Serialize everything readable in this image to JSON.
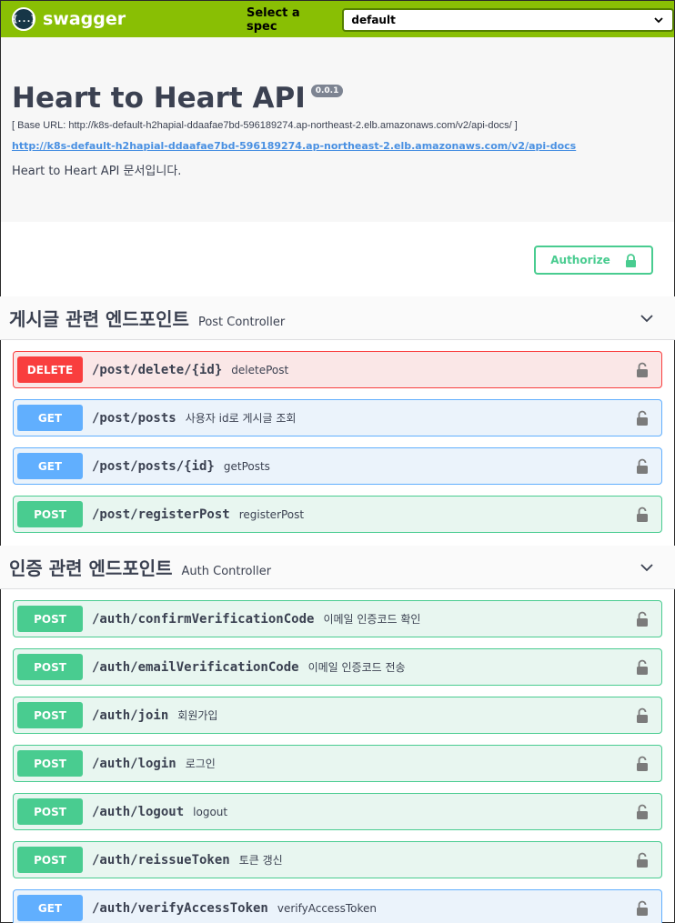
{
  "topbar": {
    "logo_glyph": "{...}",
    "logo_text": "swagger",
    "spec_label": "Select a spec",
    "spec_value": "default"
  },
  "info": {
    "title": "Heart to Heart API",
    "version": "0.0.1",
    "base_url": "[ Base URL: http://k8s-default-h2hapial-ddaafae7bd-596189274.ap-northeast-2.elb.amazonaws.com/v2/api-docs/ ]",
    "docs_link": "http://k8s-default-h2hapial-ddaafae7bd-596189274.ap-northeast-2.elb.amazonaws.com/v2/api-docs",
    "description": "Heart to Heart API 문서입니다."
  },
  "authorize": {
    "label": "Authorize"
  },
  "colors": {
    "get": "#61affe",
    "post": "#49cc90",
    "delete": "#f93e3e",
    "topbar": "#89bf04"
  },
  "sections": [
    {
      "name": "게시글 관련 엔드포인트",
      "desc": "Post Controller",
      "operations": [
        {
          "method": "DELETE",
          "path": "/post/delete/{id}",
          "summary": "deletePost"
        },
        {
          "method": "GET",
          "path": "/post/posts",
          "summary": "사용자 id로 게시글 조회"
        },
        {
          "method": "GET",
          "path": "/post/posts/{id}",
          "summary": "getPosts"
        },
        {
          "method": "POST",
          "path": "/post/registerPost",
          "summary": "registerPost"
        }
      ]
    },
    {
      "name": "인증 관련 엔드포인트",
      "desc": "Auth Controller",
      "operations": [
        {
          "method": "POST",
          "path": "/auth/confirmVerificationCode",
          "summary": "이메일 인증코드 확인"
        },
        {
          "method": "POST",
          "path": "/auth/emailVerificationCode",
          "summary": "이메일 인증코드 전송"
        },
        {
          "method": "POST",
          "path": "/auth/join",
          "summary": "회원가입"
        },
        {
          "method": "POST",
          "path": "/auth/login",
          "summary": "로그인"
        },
        {
          "method": "POST",
          "path": "/auth/logout",
          "summary": "logout"
        },
        {
          "method": "POST",
          "path": "/auth/reissueToken",
          "summary": "토큰 갱신"
        },
        {
          "method": "GET",
          "path": "/auth/verifyAccessToken",
          "summary": "verifyAccessToken"
        }
      ]
    }
  ]
}
